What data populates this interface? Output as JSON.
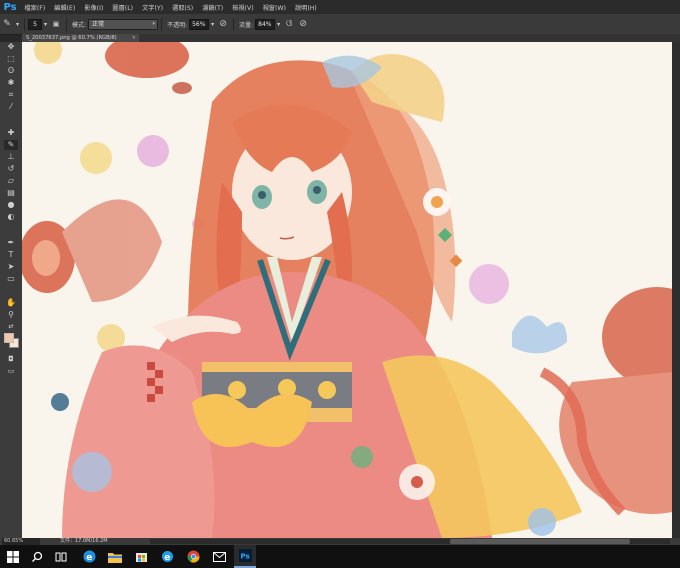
{
  "app": {
    "logo": "Ps"
  },
  "menu": [
    "檔案(F)",
    "編輯(E)",
    "影像(I)",
    "圖層(L)",
    "文字(Y)",
    "選取(S)",
    "濾鏡(T)",
    "檢視(V)",
    "視窗(W)",
    "說明(H)"
  ],
  "options": {
    "brush_size": "5",
    "mode_label": "模式:",
    "mode_value": "正常",
    "opacity_label": "不透明:",
    "opacity_value": "56%",
    "flow_label": "流量:",
    "flow_value": "84%"
  },
  "document": {
    "tab_title": "S_20037637.png @ 60.7% (RGB/8)",
    "close_glyph": "×"
  },
  "status": {
    "zoom": "60.65%",
    "doc_info": "文件：17.0M/16.2M"
  },
  "tools": [
    {
      "name": "move-tool",
      "glyph": "✥"
    },
    {
      "name": "marquee-tool",
      "glyph": "⬚"
    },
    {
      "name": "lasso-tool",
      "glyph": "ʘ"
    },
    {
      "name": "quick-select-tool",
      "glyph": "✱"
    },
    {
      "name": "crop-tool",
      "glyph": "⌗"
    },
    {
      "name": "eyedropper-tool",
      "glyph": "⁄"
    },
    {
      "name": "healing-tool",
      "glyph": "✚"
    },
    {
      "name": "brush-tool",
      "glyph": "✎"
    },
    {
      "name": "stamp-tool",
      "glyph": "⊥"
    },
    {
      "name": "history-brush-tool",
      "glyph": "↺"
    },
    {
      "name": "eraser-tool",
      "glyph": "▱"
    },
    {
      "name": "gradient-tool",
      "glyph": "▤"
    },
    {
      "name": "blur-tool",
      "glyph": "●"
    },
    {
      "name": "dodge-tool",
      "glyph": "◐"
    },
    {
      "name": "pen-tool",
      "glyph": "✒"
    },
    {
      "name": "type-tool",
      "glyph": "T"
    },
    {
      "name": "path-select-tool",
      "glyph": "➤"
    },
    {
      "name": "shape-tool",
      "glyph": "▭"
    },
    {
      "name": "hand-tool",
      "glyph": "✋"
    },
    {
      "name": "zoom-tool",
      "glyph": "⚲"
    }
  ],
  "taskbar": [
    {
      "name": "start-icon"
    },
    {
      "name": "search-icon"
    },
    {
      "name": "task-view-icon"
    },
    {
      "name": "edge-icon"
    },
    {
      "name": "file-explorer-icon"
    },
    {
      "name": "store-icon"
    },
    {
      "name": "ie-icon"
    },
    {
      "name": "chrome-icon"
    },
    {
      "name": "mail-icon"
    },
    {
      "name": "photoshop-taskbar-icon",
      "active": true
    }
  ],
  "colors": {
    "foreground": "#f1c6a9",
    "background": "#f5e6d3",
    "canvas_bg": "#f9f5ec",
    "accent": "#31a8ff"
  }
}
